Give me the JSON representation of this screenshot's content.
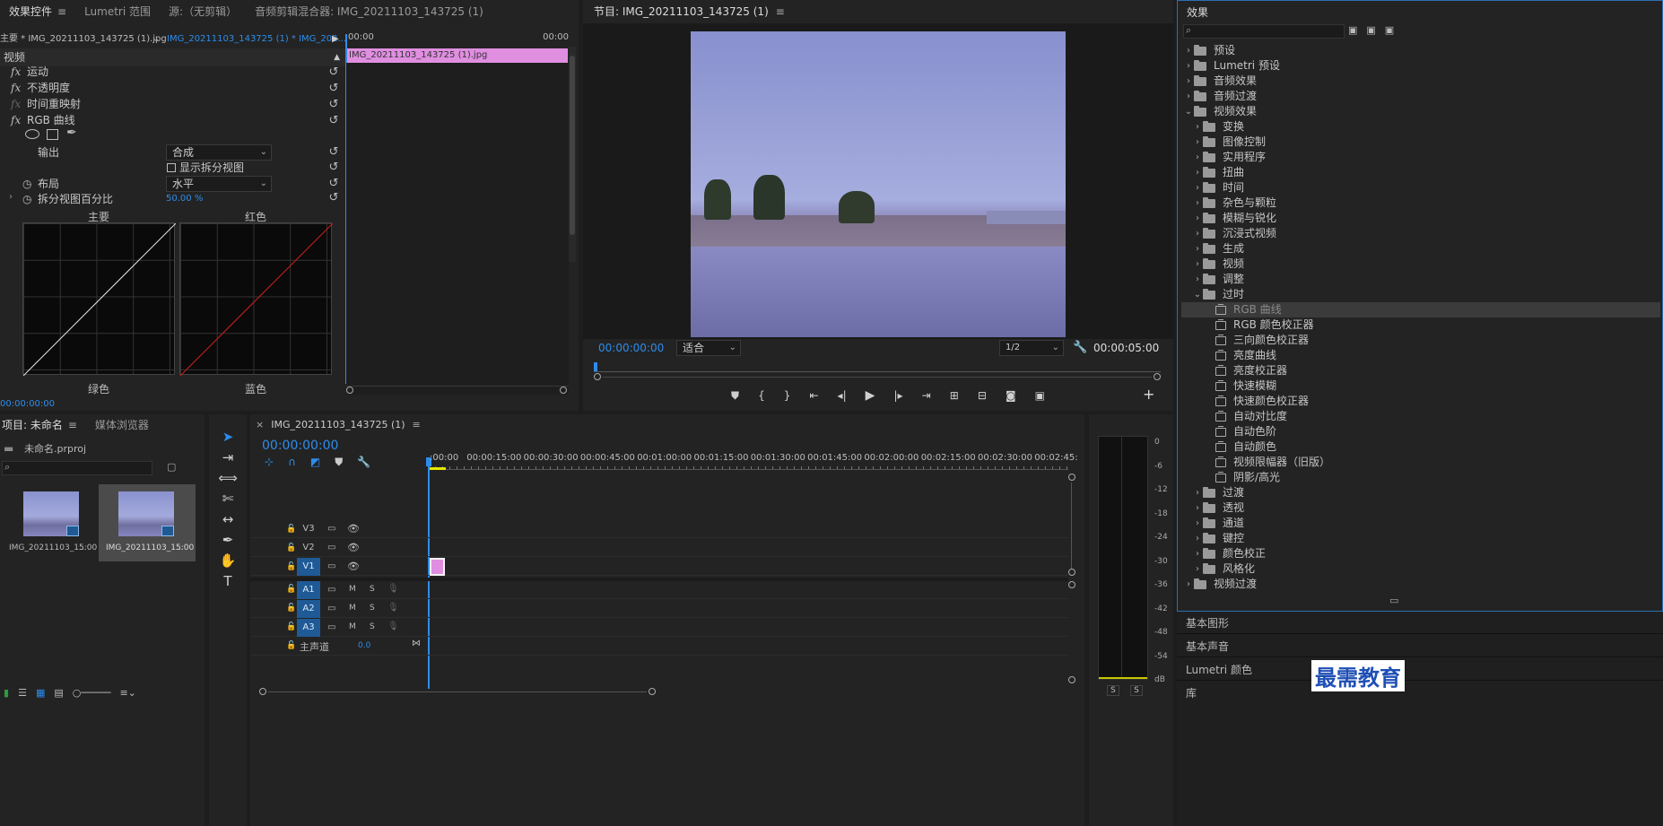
{
  "effect_controls": {
    "tabs": [
      "效果控件",
      "Lumetri 范围",
      "源:（无剪辑）",
      "音频剪辑混合器: IMG_20211103_143725 (1)"
    ],
    "master_clip": "主要 * IMG_20211103_143725 (1).jpg",
    "seq_clip": "IMG_20211103_143725 (1) * IMG_202...",
    "mini_ruler": [
      "00:00",
      "00:00"
    ],
    "clip_bar": "IMG_20211103_143725 (1).jpg",
    "section": "视频",
    "effects": [
      "运动",
      "不透明度",
      "时间重映射",
      "RGB 曲线"
    ],
    "output_label": "输出",
    "output_value": "合成",
    "split_view_label": "显示拆分视图",
    "layout_label": "布局",
    "layout_value": "水平",
    "split_pct_label": "拆分视图百分比",
    "split_pct_value": "50.00",
    "split_pct_unit": "%",
    "graphs": [
      "主要",
      "红色",
      "绿色",
      "蓝色"
    ],
    "timecode": "00:00:00:00"
  },
  "program": {
    "title": "节目: IMG_20211103_143725 (1)",
    "timecode": "00:00:00:00",
    "fit": "适合",
    "resolution": "1/2",
    "duration": "00:00:05:00"
  },
  "effects_panel": {
    "title": "效果",
    "top_items": [
      "预设",
      "Lumetri 预设",
      "音频效果",
      "音频过渡",
      "视频效果"
    ],
    "video_fx": [
      "变换",
      "图像控制",
      "实用程序",
      "扭曲",
      "时间",
      "杂色与颗粒",
      "模糊与锐化",
      "沉浸式视频",
      "生成",
      "视频",
      "调整",
      "过时"
    ],
    "obsolete": [
      "RGB 曲线",
      "RGB 颜色校正器",
      "三向颜色校正器",
      "亮度曲线",
      "亮度校正器",
      "快速模糊",
      "快速颜色校正器",
      "自动对比度",
      "自动色阶",
      "自动颜色",
      "视频限幅器（旧版）",
      "阴影/高光"
    ],
    "after": [
      "过渡",
      "透视",
      "通道",
      "键控",
      "颜色校正",
      "风格化"
    ],
    "last": "视频过渡",
    "bottom_panels": [
      "基本图形",
      "基本声音",
      "Lumetri 颜色",
      "库"
    ]
  },
  "project": {
    "tabs": [
      "项目: 未命名",
      "媒体浏览器"
    ],
    "file": "未命名.prproj",
    "items": [
      {
        "name": "IMG_20211103_1...",
        "dur": "5:00"
      },
      {
        "name": "IMG_20211103_1...",
        "dur": "5:00"
      }
    ]
  },
  "timeline": {
    "tab": "IMG_20211103_143725 (1)",
    "timecode": "00:00:00:00",
    "ruler": [
      ":00:00",
      "00:00:15:00",
      "00:00:30:00",
      "00:00:45:00",
      "00:01:00:00",
      "00:01:15:00",
      "00:01:30:00",
      "00:01:45:00",
      "00:02:00:00",
      "00:02:15:00",
      "00:02:30:00",
      "00:02:45:"
    ],
    "video_tracks": [
      "V3",
      "V2",
      "V1"
    ],
    "audio_tracks": [
      "A1",
      "A2",
      "A3"
    ],
    "master": "主声道",
    "master_val": "0.0",
    "m": "M",
    "s": "S"
  },
  "meter": {
    "labels": [
      "0",
      "-6",
      "-12",
      "-18",
      "-24",
      "-30",
      "-36",
      "-42",
      "-48",
      "-54",
      "dB"
    ],
    "solo": [
      "S",
      "S"
    ]
  },
  "watermark": "最需教育",
  "colors": {
    "accent": "#2d8ceb",
    "clip": "#e08ee0",
    "track_sel": "#1f5a96"
  }
}
